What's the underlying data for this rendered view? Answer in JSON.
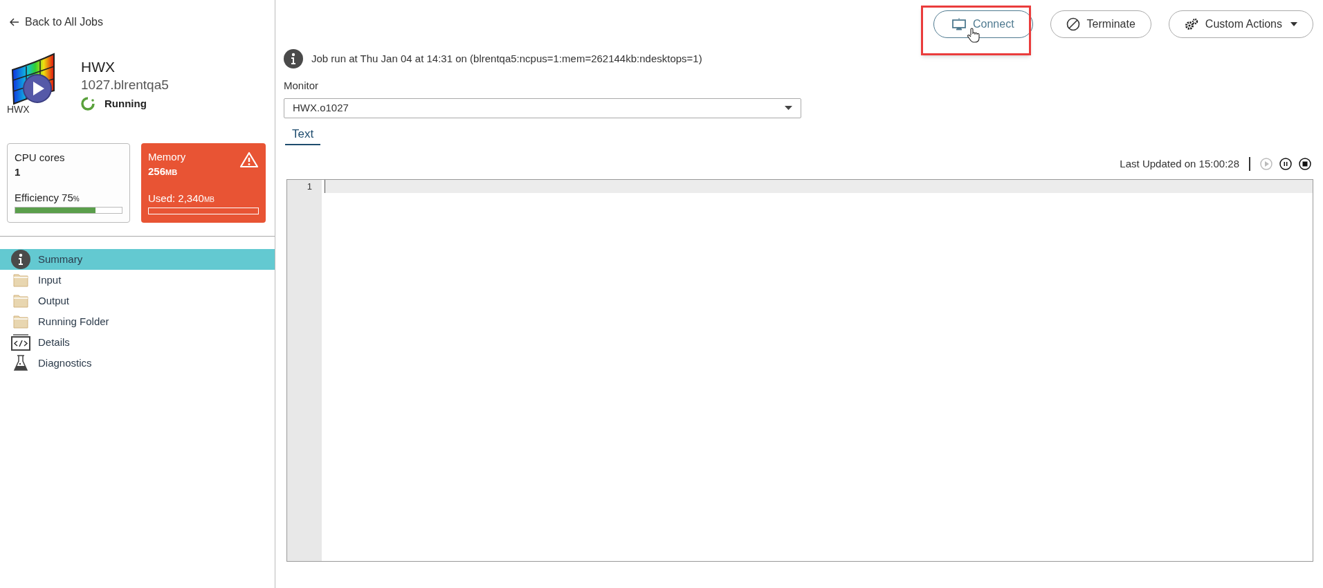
{
  "back_link": "Back to All Jobs",
  "job": {
    "app_label": "HWX",
    "title": "HWX",
    "id": "1027.blrentqa5",
    "status": "Running"
  },
  "cards": [
    {
      "kind": "normal",
      "label": "CPU cores",
      "value": "1",
      "footer": "Efficiency 75",
      "footer_unit": "%",
      "level": 0.75
    },
    {
      "kind": "alert",
      "label": "Memory",
      "value": "256",
      "value_unit": "MB",
      "footer": "Used: 2,340",
      "footer_unit": "MB"
    }
  ],
  "nav": [
    {
      "kind": "info",
      "label": "Summary",
      "selected": true
    },
    {
      "kind": "folder",
      "label": "Input",
      "selected": false
    },
    {
      "kind": "folder",
      "label": "Output",
      "selected": false
    },
    {
      "kind": "folder",
      "label": "Running Folder",
      "selected": false
    },
    {
      "kind": "code",
      "label": "Details",
      "selected": false
    },
    {
      "kind": "flask",
      "label": "Diagnostics",
      "selected": false
    }
  ],
  "actions": [
    {
      "kind": "connect",
      "label": "Connect",
      "highlighted": true
    },
    {
      "kind": "terminate",
      "label": "Terminate",
      "highlighted": false
    },
    {
      "kind": "custom",
      "label": "Custom Actions",
      "highlighted": false
    }
  ],
  "info": "Job run at Thu Jan 04 at 14:31 on (blrentqa5:ncpus=1:mem=262144kb:ndesktops=1)",
  "monitor": {
    "label": "Monitor",
    "value": "HWX.o1027"
  },
  "tabs": [
    {
      "label": "Text",
      "selected": true
    }
  ],
  "last_updated": "Last Updated on 15:00:28",
  "playback": [
    {
      "kind": "play",
      "disabled": true
    },
    {
      "kind": "pause",
      "disabled": false
    },
    {
      "kind": "stop",
      "disabled": false
    }
  ],
  "editor": {
    "line_numbers": [
      "1"
    ]
  }
}
